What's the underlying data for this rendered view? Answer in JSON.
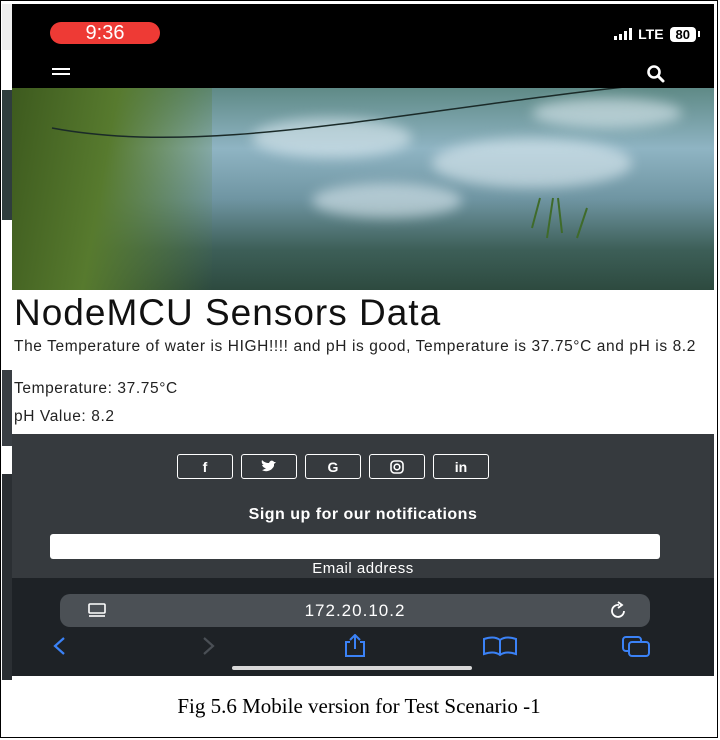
{
  "status_bar": {
    "time": "9:36",
    "network": "LTE",
    "battery": "80"
  },
  "page": {
    "title": "NodeMCU Sensors Data",
    "status_message": "The Temperature of water is HIGH!!!! and pH is good, Temperature is 37.75°C and pH is 8.2",
    "temperature_line": "Temperature: 37.75°C",
    "ph_line": "pH Value: 8.2"
  },
  "footer": {
    "social_buttons": [
      "f",
      "twitter",
      "G",
      "instagram",
      "in"
    ],
    "signup_heading": "Sign up for our notifications",
    "email_label": "Email address"
  },
  "browser": {
    "url": "172.20.10.2"
  },
  "caption": "Fig 5.6 Mobile version for Test Scenario -1",
  "colors": {
    "time_pill": "#ee3a35",
    "footer_bg": "#363a3e",
    "toolbar_icons": "#3b82f6"
  }
}
